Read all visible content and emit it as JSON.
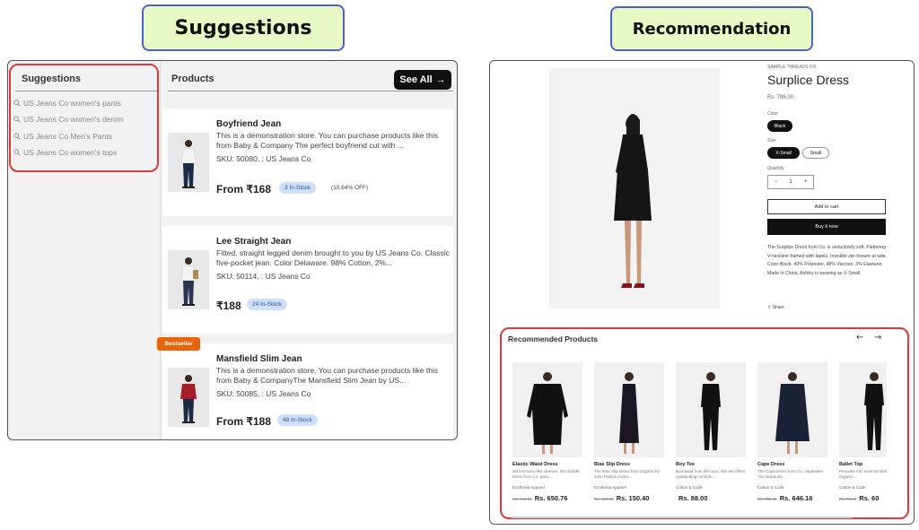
{
  "labels": {
    "suggestions": "Suggestions",
    "recommendation": "Recommendation"
  },
  "left": {
    "suggestions_title": "Suggestions",
    "suggestions": [
      "US Jeans Co women's pants",
      "US Jeans Co women's denim",
      "US Jeans Co Men's Pants",
      "US Jeans Co women's tops"
    ],
    "products_title": "Products",
    "see_all": "See All",
    "bestseller": "Bestseller",
    "products": [
      {
        "name": "Boyfriend Jean",
        "desc": "This is a demonstration store. You can purchase products like this from Baby & Company The perfect boyfriend cut with ...",
        "sku": "SKU: 50080, : US Jeans Co",
        "price": "From ₹168",
        "stock": "3 In-Stock",
        "discount": "(10.64% OFF)"
      },
      {
        "name": "Lee Straight Jean",
        "desc": "Fitted, straight legged denim brought to you by US Jeans Co. Classic five-pocket jean. Color Delaware. 98% Cotton, 2%...",
        "sku": "SKU: 50114, : US Jeans Co",
        "price": "₹188",
        "stock": "24 In-Stock",
        "discount": ""
      },
      {
        "name": "Mansfield Slim Jean",
        "desc": "This is a demonstration store. You can purchase products like this from Baby & CompanyThe Mansfield Slim Jean by US...",
        "sku": "SKU: 50085, : US Jeans Co",
        "price": "From ₹188",
        "stock": "48 In-Stock",
        "discount": ""
      }
    ]
  },
  "right": {
    "vendor": "SAMPLE THREADS CO.",
    "title": "Surplice Dress",
    "price": "Rs. 786.00",
    "color_label": "Color",
    "color_value": "Black",
    "size_label": "Size",
    "sizes": [
      "X-Small",
      "Small"
    ],
    "quantity_label": "Quantity",
    "quantity": "1",
    "add_to_cart": "Add to cart",
    "buy_now": "Buy it now",
    "description": "The Surplice Dress from Co. is seductively soft. Flattering V-neckline framed with lapels. Invisible zip closure at side. Color Black. 49% Polyester, 48% Viscose, 3% Elastane. Made in China. Ashley is wearing an X-Small.",
    "share": "Share",
    "rec_title": "Recommended Products",
    "recommended": [
      {
        "name": "Elastic Waist Dress",
        "desc": "With Kimono-like sleeves, this sheath dress from Co. pairs...",
        "brand": "Ecothreat Apparel",
        "old_price": "Rs. 748.00",
        "price": "Rs. 650.76"
      },
      {
        "name": "Bias Slip Dress",
        "desc": "The Bias Slip Dress from Organic by John Patrick invites...",
        "brand": "Ecothreat Apparel",
        "old_price": "Rs. 188.00",
        "price": "Rs. 150.40"
      },
      {
        "name": "Boy Tee",
        "desc": "Borrowed from the boys, this tee offers outstanding comfort...",
        "brand": "Cotton & Code",
        "old_price": "",
        "price": "Rs. 88.00"
      },
      {
        "name": "Cape Dress",
        "desc": "The Cape Dress from Co. captivates. The wardrobe...",
        "brand": "Cotton & Code",
        "old_price": "Rs. 788.00",
        "price": "Rs. 646.16"
      },
      {
        "name": "Ballet Top",
        "desc": "Pirouette into summer Ballet Top from Organic...",
        "brand": "Cotton & Code",
        "old_price": "Rs. 78.00",
        "price": "Rs. 60"
      }
    ]
  }
}
